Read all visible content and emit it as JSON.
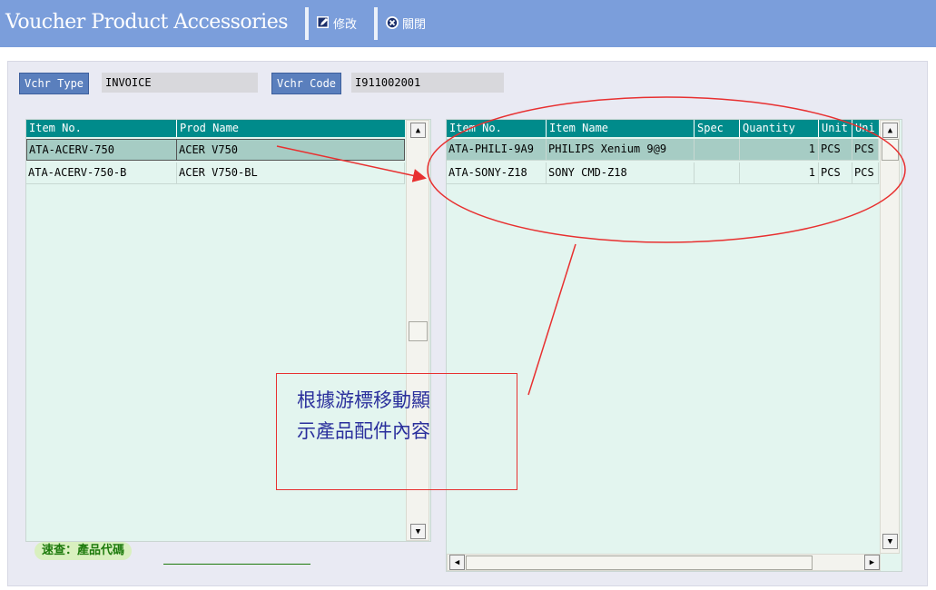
{
  "window": {
    "title": "Voucher Product Accessories",
    "toolbar": {
      "edit_label": "修改",
      "close_label": "關閉"
    }
  },
  "header": {
    "vchr_type_label": "Vchr Type",
    "vchr_type_value": "INVOICE",
    "vchr_code_label": "Vchr Code",
    "vchr_code_value": "I911002001"
  },
  "left_grid": {
    "columns": [
      "Item No.",
      "Prod Name"
    ],
    "rows": [
      {
        "item_no": "ATA-ACERV-750",
        "prod_name": "ACER V750",
        "selected": true
      },
      {
        "item_no": "ATA-ACERV-750-B",
        "prod_name": "ACER V750-BL",
        "selected": false
      }
    ]
  },
  "right_grid": {
    "columns": [
      "Item No.",
      "Item Name",
      "Spec",
      "Quantity",
      "Unit",
      "Uni"
    ],
    "rows": [
      {
        "item_no": "ATA-PHILI-9A9",
        "item_name": "PHILIPS Xenium 9@9",
        "spec": "",
        "quantity": "1",
        "unit": "PCS",
        "unit2": "PCS"
      },
      {
        "item_no": "ATA-SONY-Z18",
        "item_name": "SONY CMD-Z18",
        "spec": "",
        "quantity": "1",
        "unit": "PCS",
        "unit2": "PCS"
      }
    ]
  },
  "quick_search": {
    "label": "速查：產品代碼",
    "value": ""
  },
  "annotation": {
    "line1": "根據游標移動顯",
    "line2": "示產品配件內容"
  },
  "colors": {
    "titlebar": "#7b9edb",
    "grid_header": "#008b8b",
    "grid_bg": "#e3f5ef",
    "annotation_red": "#e83030",
    "annotation_text": "#2a2f9c"
  },
  "icons": [
    "edit-icon",
    "close-circle-icon",
    "up-arrow-icon",
    "down-arrow-icon",
    "left-arrow-icon",
    "right-arrow-icon"
  ]
}
